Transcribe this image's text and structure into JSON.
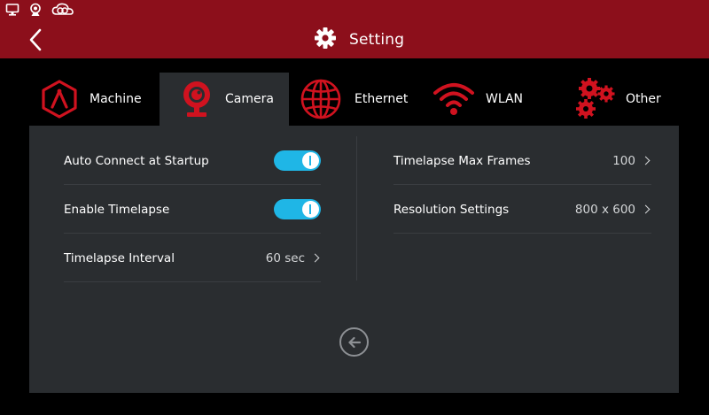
{
  "header": {
    "title": "Setting",
    "bg_color": "#8c0f1b",
    "status_icons": [
      "monitor-icon",
      "webcam-icon",
      "cloud-link-icon"
    ]
  },
  "tabs": [
    {
      "label": "Machine",
      "icon": "machine-hexagon-icon",
      "active": false
    },
    {
      "label": "Camera",
      "icon": "camera-icon",
      "active": true
    },
    {
      "label": "Ethernet",
      "icon": "globe-icon",
      "active": false
    },
    {
      "label": "WLAN",
      "icon": "wifi-icon",
      "active": false
    },
    {
      "label": "Other",
      "icon": "gears-icon",
      "active": false
    }
  ],
  "left": {
    "auto_connect": {
      "label": "Auto Connect at Startup",
      "on": true
    },
    "enable_timelapse": {
      "label": "Enable Timelapse",
      "on": true
    },
    "timelapse_interval": {
      "label": "Timelapse Interval",
      "value": "60 sec"
    }
  },
  "right": {
    "max_frames": {
      "label": "Timelapse Max Frames",
      "value": "100"
    },
    "resolution": {
      "label": "Resolution Settings",
      "value": "800 x 600"
    }
  },
  "colors": {
    "accent_red": "#c8102e",
    "toggle_on": "#1fb6e6",
    "panel": "#2a2d30"
  }
}
